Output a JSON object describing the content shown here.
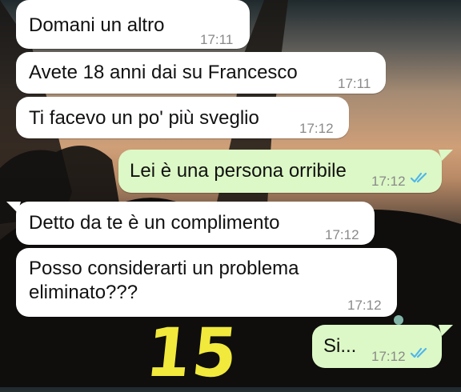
{
  "messages": [
    {
      "text": "Domani un altro",
      "time": "17:11",
      "direction": "in"
    },
    {
      "text": "Avete 18 anni dai su Francesco",
      "time": "17:11",
      "direction": "in"
    },
    {
      "text": "Ti facevo un po' più sveglio",
      "time": "17:12",
      "direction": "in"
    },
    {
      "text": "Lei è una persona orribile",
      "time": "17:12",
      "direction": "out",
      "status": "read"
    },
    {
      "text": "Detto da te è un complimento",
      "time": "17:12",
      "direction": "in"
    },
    {
      "text": "Posso considerarti un problema\neliminato???",
      "time": "17:12",
      "direction": "in"
    },
    {
      "text": "Si...",
      "time": "17:12",
      "direction": "out",
      "status": "read"
    }
  ],
  "overlay_number": "15",
  "colors": {
    "incoming_bubble": "#ffffff",
    "outgoing_bubble": "#dcf8c6",
    "read_ticks": "#4fb6ec",
    "overlay_text": "#f1e93b"
  },
  "icons": {
    "read_receipt": "double-check-icon"
  }
}
